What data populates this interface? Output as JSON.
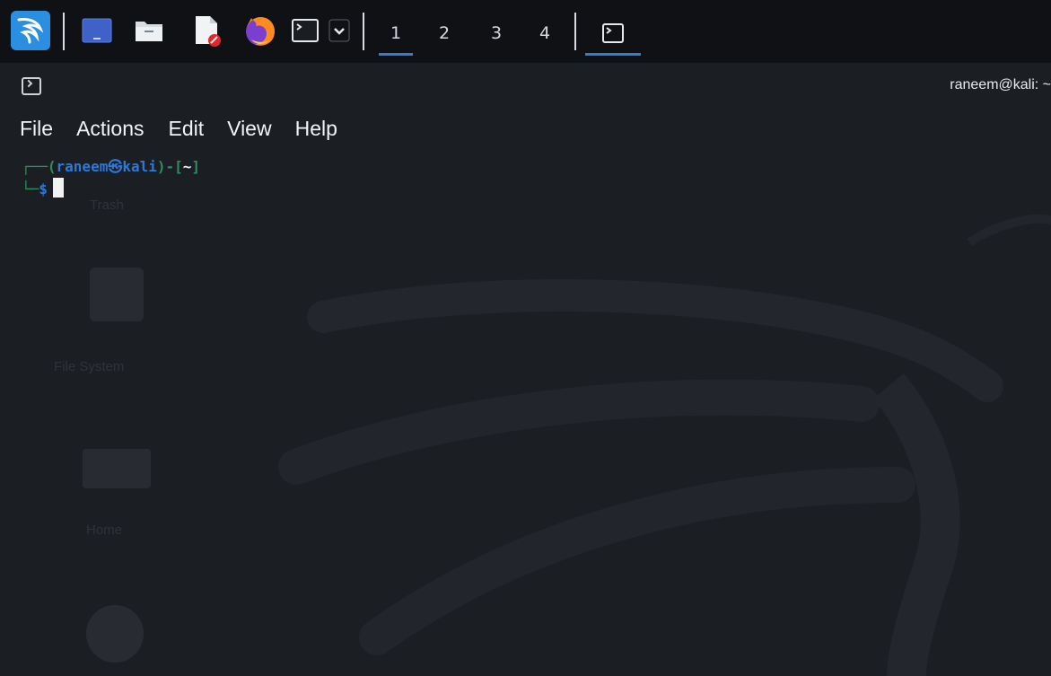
{
  "panel": {
    "launchers": [
      {
        "name": "kali-menu-icon"
      },
      {
        "name": "show-desktop-icon"
      },
      {
        "name": "file-manager-icon"
      },
      {
        "name": "text-editor-icon"
      },
      {
        "name": "firefox-icon"
      },
      {
        "name": "terminal-launcher-icon"
      },
      {
        "name": "chevron-down-icon"
      }
    ],
    "workspaces": [
      "1",
      "2",
      "3",
      "4"
    ],
    "active_workspace": "1"
  },
  "window": {
    "title": "raneem@kali: ~",
    "menu": [
      "File",
      "Actions",
      "Edit",
      "View",
      "Help"
    ]
  },
  "terminal": {
    "line1": {
      "corner": "┌──(",
      "user": "raneem",
      "at": "㉿",
      "host": "kali",
      "close": ")-[",
      "path": "~",
      "end": "]"
    },
    "line2": {
      "corner": "└─",
      "prompt": "$"
    }
  },
  "desktop_ghosts": [
    "Trash",
    "File System",
    "Home"
  ],
  "colors": {
    "panel_bg": "#0f1115",
    "terminal_bg": "#1a1d22",
    "accent": "#2f7fd8",
    "prompt_green": "#2d8f5d",
    "prompt_blue": "#2e78d6"
  }
}
